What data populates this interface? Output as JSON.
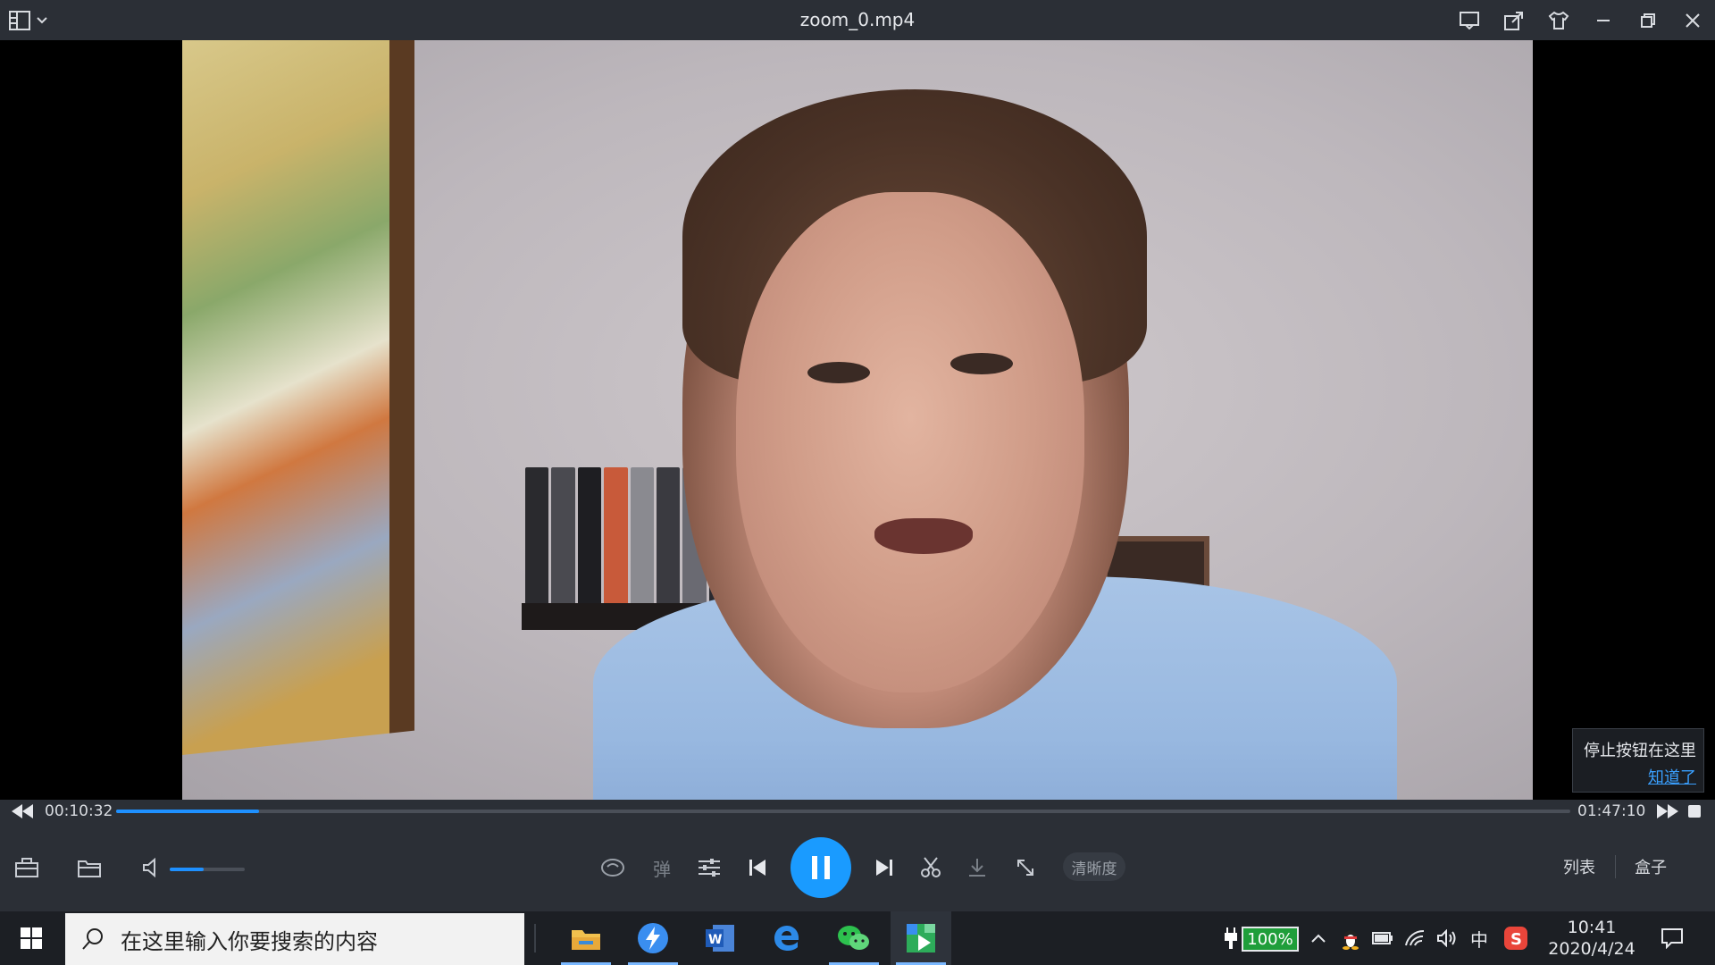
{
  "window": {
    "title": "zoom_0.mp4"
  },
  "tooltip": {
    "message": "停止按钮在这里",
    "link": "知道了"
  },
  "progress": {
    "current_time": "00:10:32",
    "total_time": "01:47:10",
    "played_fraction": 0.098
  },
  "volume": {
    "level_fraction": 0.45
  },
  "controls": {
    "danmaku_label": "弹",
    "quality_label": "清晰度",
    "list_label": "列表",
    "box_label": "盒子"
  },
  "taskbar": {
    "search_placeholder": "在这里输入你要搜索的内容",
    "battery_percent": "100%",
    "ime_label": "中",
    "clock_time": "10:41",
    "clock_date": "2020/4/24"
  },
  "colors": {
    "accent": "#1a9bff",
    "chrome_bg": "#2b2f36",
    "taskbar_bg": "#1c1f24",
    "battery_green": "#1f9e3a"
  },
  "icons": {
    "titlebar": [
      "layout-menu-icon",
      "chevron-down-icon",
      "message-icon",
      "share-icon",
      "skin-shirt-icon",
      "minimize-icon",
      "restore-icon",
      "close-icon"
    ],
    "controls": [
      "toolbox-icon",
      "open-folder-icon",
      "speaker-icon",
      "eye-icon",
      "danmaku-icon",
      "equalizer-icon",
      "previous-icon",
      "pause-icon",
      "next-icon",
      "scissors-icon",
      "download-icon",
      "fullscreen-icon"
    ]
  }
}
